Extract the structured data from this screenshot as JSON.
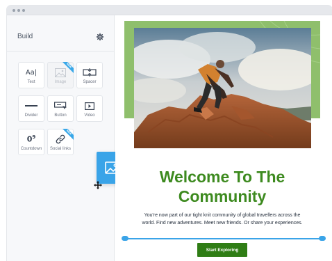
{
  "window": {
    "dots": 3
  },
  "sidebar": {
    "title": "Build",
    "settings_icon": "gear-icon",
    "blocks": [
      {
        "label": "Text",
        "icon": "text-icon",
        "disabled": false,
        "badge": ""
      },
      {
        "label": "Image",
        "icon": "image-icon",
        "disabled": true,
        "badge": "NEW"
      },
      {
        "label": "Spacer",
        "icon": "spacer-icon",
        "disabled": false,
        "badge": ""
      },
      {
        "label": "Divider",
        "icon": "divider-icon",
        "disabled": false,
        "badge": ""
      },
      {
        "label": "Button",
        "icon": "button-icon",
        "disabled": false,
        "badge": ""
      },
      {
        "label": "Video",
        "icon": "video-icon",
        "disabled": false,
        "badge": ""
      },
      {
        "label": "Countdown",
        "icon": "countdown-icon",
        "disabled": false,
        "badge": ""
      },
      {
        "label": "Social links",
        "icon": "link-icon",
        "disabled": false,
        "badge": "NEW"
      }
    ],
    "drag_icon": "image-icon",
    "cursor_icon": "move-cursor-icon"
  },
  "email": {
    "headline_line1": "Welcome To The",
    "headline_line2": "Community",
    "body_line1": "You're now part of our tight knit community of global travellers across the",
    "body_line2": "world. Find new adventures. Meet new friends. Or share your experiences.",
    "cta_label": "Start Exploring",
    "hero_image": "hiker-climbing-rocks",
    "colors": {
      "accent": "#3aa4e8",
      "headline": "#3d8a1f",
      "cta": "#2f7d15",
      "hero_frame": "#8fbf6c"
    }
  }
}
